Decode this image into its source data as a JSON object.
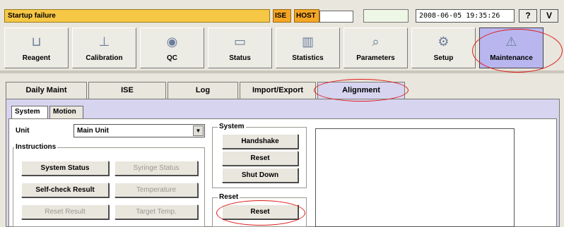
{
  "status": {
    "alarm_text": "Startup failure",
    "ise_label": "ISE",
    "host_label": "HOST",
    "datetime": "2008-06-05 19:35:26",
    "help_label": "?",
    "v_label": "V"
  },
  "toolbar": {
    "items": [
      {
        "label": "Reagent",
        "icon": "reagent-icon"
      },
      {
        "label": "Calibration",
        "icon": "calibration-icon"
      },
      {
        "label": "QC",
        "icon": "qc-icon"
      },
      {
        "label": "Status",
        "icon": "status-icon"
      },
      {
        "label": "Statistics",
        "icon": "statistics-icon"
      },
      {
        "label": "Parameters",
        "icon": "parameters-icon"
      },
      {
        "label": "Setup",
        "icon": "setup-icon"
      },
      {
        "label": "Maintenance",
        "icon": "maintenance-icon"
      }
    ],
    "active": "Maintenance"
  },
  "tabs": [
    {
      "label": "Daily Maint"
    },
    {
      "label": "ISE"
    },
    {
      "label": "Log"
    },
    {
      "label": "Import/Export"
    },
    {
      "label": "Alignment"
    }
  ],
  "selected_tab": "Alignment",
  "subtabs": [
    {
      "label": "System"
    },
    {
      "label": "Motion"
    }
  ],
  "unit": {
    "label": "Unit",
    "value": "Main Unit"
  },
  "instructions": {
    "title": "Instructions",
    "buttons": [
      {
        "label": "System Status",
        "enabled": true
      },
      {
        "label": "Syringe Status",
        "enabled": false
      },
      {
        "label": "Self-check Result",
        "enabled": true
      },
      {
        "label": "Temperature",
        "enabled": false
      },
      {
        "label": "Reset Result",
        "enabled": false
      },
      {
        "label": "Target Temp.",
        "enabled": false
      }
    ]
  },
  "system_group": {
    "title": "System",
    "buttons": [
      "Handshake",
      "Reset",
      "Shut Down"
    ]
  },
  "reset_group": {
    "title": "Reset",
    "button": "Reset"
  },
  "colors": {
    "alarm_bg": "#f6c744",
    "tag_bg": "#f5a623",
    "active_toolbar": "#b9b6ef",
    "panel_bg": "#d6d4ef",
    "annotation": "#e01818"
  }
}
